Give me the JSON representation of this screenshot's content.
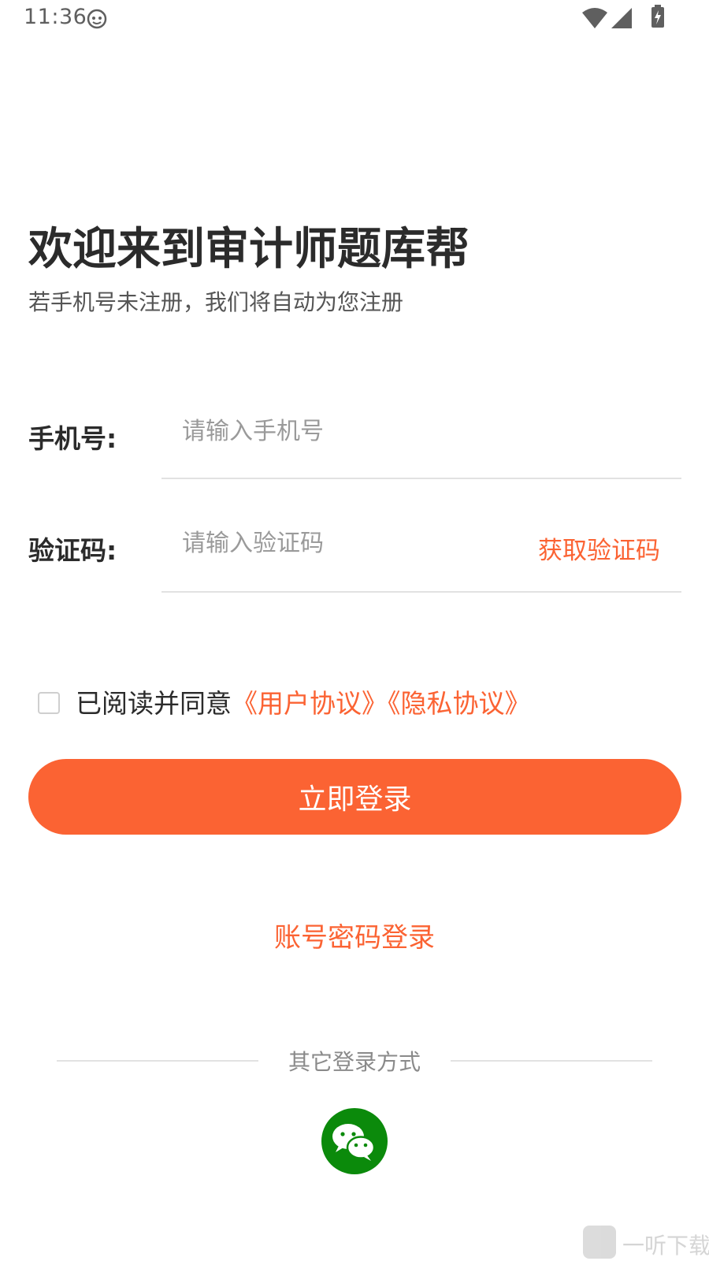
{
  "status_bar": {
    "time": "11:36"
  },
  "header": {
    "title": "欢迎来到审计师题库帮",
    "subtitle": "若手机号未注册，我们将自动为您注册"
  },
  "form": {
    "phone": {
      "label": "手机号:",
      "placeholder": "请输入手机号",
      "value": ""
    },
    "code": {
      "label": "验证码:",
      "placeholder": "请输入验证码",
      "value": "",
      "get_code_label": "获取验证码"
    }
  },
  "agreement": {
    "checked": false,
    "prefix": "已阅读并同意",
    "user_agreement": "《用户协议》",
    "privacy_policy": "《隐私协议》"
  },
  "login_button": "立即登录",
  "password_login": "账号密码登录",
  "other_login": {
    "label": "其它登录方式",
    "wechat_icon": "wechat-icon"
  },
  "watermark": {
    "text": "一听下载"
  },
  "colors": {
    "accent": "#fb6333",
    "wechat": "#0b8a0b"
  }
}
